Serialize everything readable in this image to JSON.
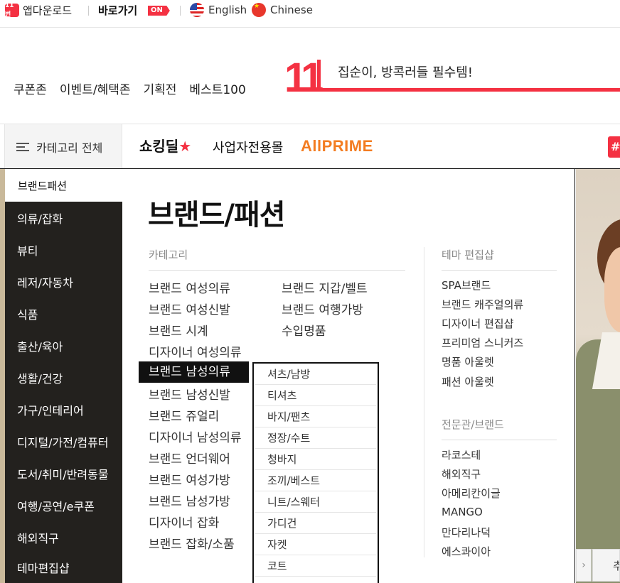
{
  "topbar": {
    "app_logo": "11번",
    "app_download": "앱다운로드",
    "shortcut": "바로가기",
    "shortcut_badge": "ON",
    "languages": [
      "English",
      "Chinese"
    ]
  },
  "header": {
    "quick_links": [
      "쿠폰존",
      "이벤트/혜택존",
      "기획전",
      "베스트100"
    ],
    "logo_text": "11",
    "slogan": "집순이, 방콕러들 필수템!",
    "accent": "#f43142"
  },
  "nav": {
    "category_all": "카테고리 전체",
    "items": [
      "쇼킹딜",
      "사업자전용몰",
      "AllPRIME"
    ],
    "hash": "#"
  },
  "sidebar": {
    "active": "브랜드패션",
    "items": [
      "의류/잡화",
      "뷰티",
      "레저/자동차",
      "식품",
      "출산/육아",
      "생활/건강",
      "가구/인테리어",
      "디지털/가전/컴퓨터",
      "도서/취미/반려동물",
      "여행/공연/e쿠폰",
      "해외직구",
      "테마편집샵"
    ]
  },
  "panel": {
    "title": "브랜드/패션",
    "category_head": "카테고리",
    "col1": [
      "브랜드 여성의류",
      "브랜드 여성신발",
      "브랜드 시계",
      "디자이너 여성의류",
      "브랜드 남성의류",
      "브랜드 남성신발",
      "브랜드 쥬얼리",
      "디자이너 남성의류",
      "브랜드 언더웨어",
      "브랜드 여성가방",
      "브랜드 남성가방",
      "디자이너 잡화",
      "브랜드 잡화/소품"
    ],
    "col2": [
      "브랜드 지갑/벨트",
      "브랜드 여행가방",
      "수입명품"
    ],
    "active_index": 4,
    "theme_head": "테마 편집샵",
    "theme_items": [
      "SPA브랜드",
      "브랜드 캐주얼의류",
      "디자이너 편집샵",
      "프리미엄 스니커즈",
      "명품 아울렛",
      "패션 아울렛"
    ],
    "special_head": "전문관/브랜드",
    "special_items": [
      "라코스테",
      "해외직구",
      "아메리칸이글",
      "MANGO",
      "만다리나덕",
      "에스콰이아"
    ]
  },
  "submenu": {
    "items": [
      "셔츠/남방",
      "티셔츠",
      "바지/팬츠",
      "정장/수트",
      "청바지",
      "조끼/베스트",
      "니트/스웨터",
      "가디건",
      "자켓",
      "코트"
    ]
  },
  "banner": {
    "arrow": "›",
    "tab_label": "추"
  }
}
